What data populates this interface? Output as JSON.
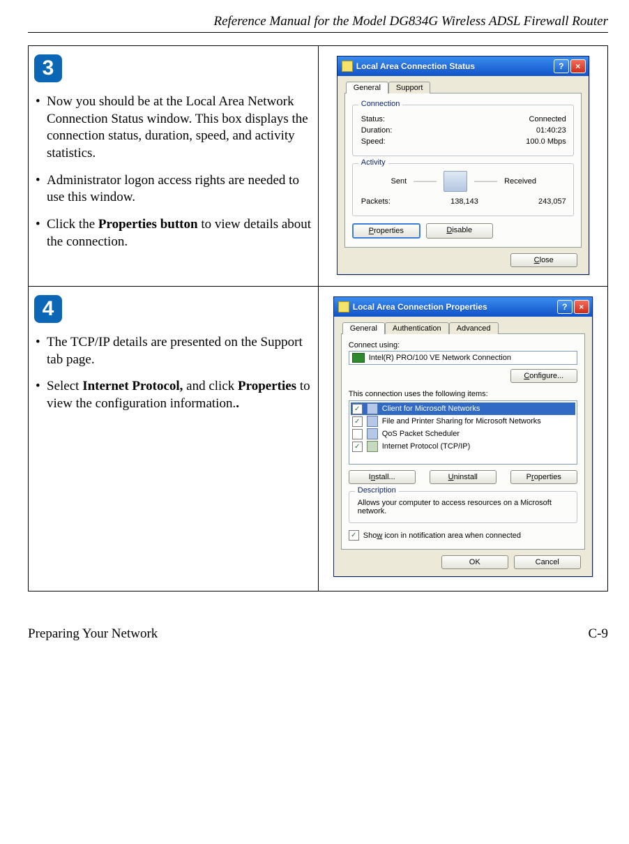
{
  "header": {
    "title": "Reference Manual for the Model DG834G Wireless ADSL Firewall Router"
  },
  "footer": {
    "left": "Preparing Your Network",
    "right": "C-9"
  },
  "steps": [
    {
      "badge": "3",
      "bullets": [
        {
          "pre": "Now you should be at the Local Area Network Connection Status window. This box displays the connection status, duration, speed, and activity statistics."
        },
        {
          "pre": "Administrator logon access rights are needed to use this window."
        },
        {
          "pre": "Click the ",
          "bold": "Properties button",
          "post": " to view details about the connection."
        }
      ]
    },
    {
      "badge": "4",
      "bullets": [
        {
          "pre": "The TCP/IP details are presented on the Support tab page."
        },
        {
          "pre": "Select ",
          "bold": "Internet Protocol,",
          "mid": " and click ",
          "bold2": "Properties",
          "post": " to view the configuration information."
        }
      ]
    }
  ],
  "win_status": {
    "title": "Local Area Connection Status",
    "tabs": {
      "general": "General",
      "support": "Support"
    },
    "conn_group": "Connection",
    "status_label": "Status:",
    "status_val": "Connected",
    "duration_label": "Duration:",
    "duration_val": "01:40:23",
    "speed_label": "Speed:",
    "speed_val": "100.0 Mbps",
    "activity_group": "Activity",
    "sent": "Sent",
    "received": "Received",
    "packets_label": "Packets:",
    "sent_val": "138,143",
    "recv_val": "243,057",
    "btn_properties": "Properties",
    "btn_disable": "Disable",
    "btn_close": "Close"
  },
  "win_props": {
    "title": "Local Area Connection Properties",
    "tabs": {
      "general": "General",
      "auth": "Authentication",
      "adv": "Advanced"
    },
    "connect_using": "Connect using:",
    "nic": "Intel(R) PRO/100 VE Network Connection",
    "btn_configure": "Configure...",
    "items_label": "This connection uses the following items:",
    "items": [
      {
        "checked": true,
        "label": "Client for Microsoft Networks",
        "selected": true
      },
      {
        "checked": true,
        "label": "File and Printer Sharing for Microsoft Networks"
      },
      {
        "checked": false,
        "label": "QoS Packet Scheduler"
      },
      {
        "checked": true,
        "label": "Internet Protocol (TCP/IP)"
      }
    ],
    "btn_install": "Install...",
    "btn_uninstall": "Uninstall",
    "btn_properties": "Properties",
    "desc_group": "Description",
    "desc_text": "Allows your computer to access resources on a Microsoft network.",
    "show_icon_pre": "Sho",
    "show_icon_u": "w",
    "show_icon_post": " icon in notification area when connected",
    "btn_ok": "OK",
    "btn_cancel": "Cancel"
  }
}
